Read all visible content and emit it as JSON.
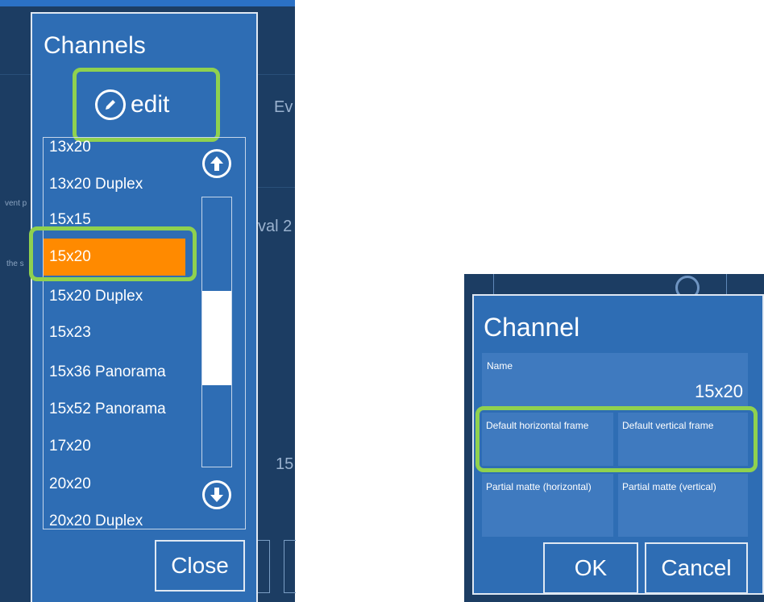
{
  "channels_dialog": {
    "title": "Channels",
    "edit_label": "edit",
    "items": [
      "13x20",
      "13x20 Duplex",
      "15x15",
      "15x20",
      "15x20 Duplex",
      "15x23",
      "15x36 Panorama",
      "15x52 Panorama",
      "17x20",
      "20x20",
      "20x20 Duplex"
    ],
    "selected_item": "15x20",
    "close_label": "Close"
  },
  "background_left": {
    "text_ev": "Ev",
    "text_val": "val 2",
    "text_15": "15",
    "small_1": "vent p",
    "small_2": "the s"
  },
  "channel_dialog": {
    "title": "Channel",
    "name_label": "Name",
    "name_value": "15x20",
    "default_horizontal_frame": "Default horizontal frame",
    "default_vertical_frame": "Default vertical frame",
    "partial_matte_horizontal": "Partial matte (horizontal)",
    "partial_matte_vertical": "Partial matte (vertical)",
    "ok_label": "OK",
    "cancel_label": "Cancel"
  },
  "colors": {
    "panel_blue": "#2e6db4",
    "background_navy": "#1c3d63",
    "selected_orange": "#ff8a00",
    "highlight_green": "#8fd14f"
  }
}
